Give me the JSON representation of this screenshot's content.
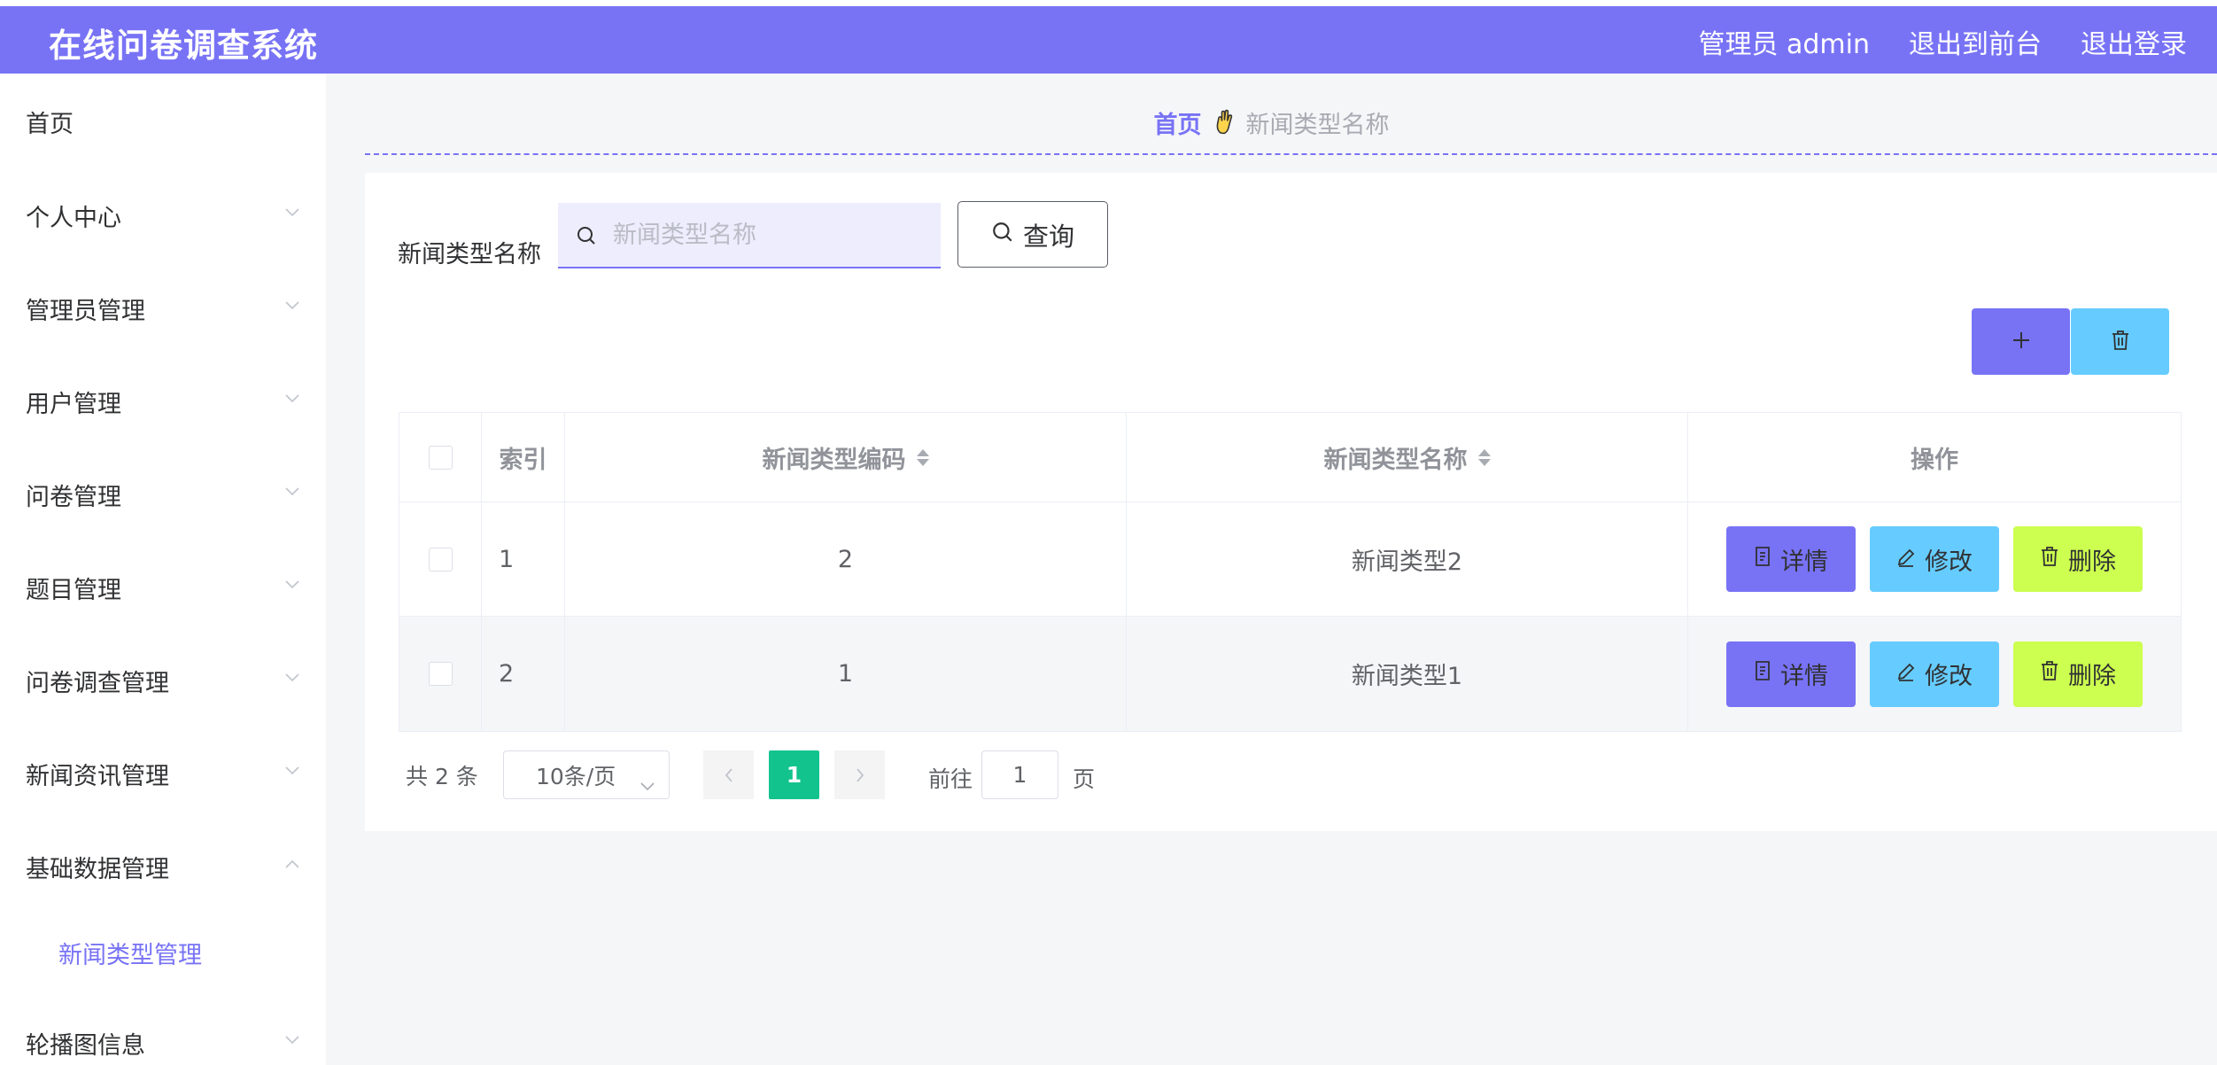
{
  "header": {
    "title": "在线问卷调查系统",
    "user_label": "管理员 admin",
    "exit_front": "退出到前台",
    "logout": "退出登录"
  },
  "sidebar": {
    "items": [
      {
        "label": "首页",
        "expandable": false
      },
      {
        "label": "个人中心",
        "expandable": true
      },
      {
        "label": "管理员管理",
        "expandable": true
      },
      {
        "label": "用户管理",
        "expandable": true
      },
      {
        "label": "问卷管理",
        "expandable": true
      },
      {
        "label": "题目管理",
        "expandable": true
      },
      {
        "label": "问卷调查管理",
        "expandable": true
      },
      {
        "label": "新闻资讯管理",
        "expandable": true
      },
      {
        "label": "基础数据管理",
        "expandable": true,
        "expanded": true
      },
      {
        "label": "新闻类型管理",
        "sub": true,
        "active": true
      },
      {
        "label": "轮播图信息",
        "expandable": true
      }
    ]
  },
  "breadcrumb": {
    "home": "首页",
    "current": "新闻类型名称"
  },
  "search": {
    "label": "新闻类型名称",
    "placeholder": "新闻类型名称",
    "value": "",
    "button_label": "查询"
  },
  "table": {
    "headers": {
      "index": "索引",
      "code": "新闻类型编码",
      "name": "新闻类型名称",
      "ops": "操作"
    },
    "rows": [
      {
        "index": "1",
        "code": "2",
        "name": "新闻类型2"
      },
      {
        "index": "2",
        "code": "1",
        "name": "新闻类型1"
      }
    ],
    "actions": {
      "detail": "详情",
      "edit": "修改",
      "delete": "删除"
    }
  },
  "pagination": {
    "total": "共 2 条",
    "page_size": "10条/页",
    "current_page": "1",
    "goto_label": "前往",
    "goto_value": "1",
    "goto_unit": "页"
  },
  "colors": {
    "primary": "#7873f5",
    "info": "#66ccff",
    "danger": "#ccff4f",
    "pager_active": "#13c38d"
  }
}
